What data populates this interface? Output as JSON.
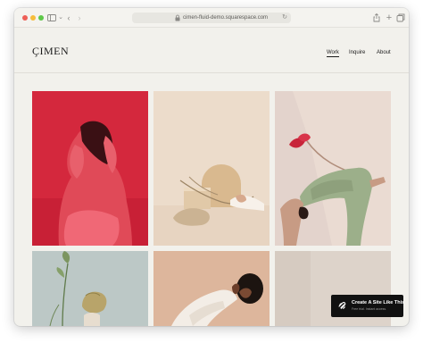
{
  "browser": {
    "url": "cimen-fluid-demo.squarespace.com"
  },
  "site": {
    "logo": "ÇIMEN",
    "nav": [
      {
        "label": "Work",
        "active": true
      },
      {
        "label": "Inquire",
        "active": false
      },
      {
        "label": "About",
        "active": false
      }
    ]
  },
  "gallery": {
    "tiles": [
      {
        "subject": "person in red with hands on head",
        "background": "#d4283d"
      },
      {
        "subject": "still life with dried flowers on cream background",
        "background": "#ecdccb"
      },
      {
        "subject": "person in green trousers bending backwards holding a flower",
        "background": "#e3d3cc"
      },
      {
        "subject": "plant stems on sage background",
        "background": "#bcc8c6"
      },
      {
        "subject": "person reclining on peach background",
        "background": "#ddb69c"
      },
      {
        "subject": "neutral beige backdrop",
        "background": "#ddd3ca"
      }
    ]
  },
  "cta": {
    "title": "Create A Site Like This",
    "subtitle": "Free trial. Instant access.",
    "icon": "squarespace-logo-icon"
  },
  "colors": {
    "page_background": "#f2f1ec",
    "text": "#1b1b1b",
    "cta_background": "#111111"
  }
}
